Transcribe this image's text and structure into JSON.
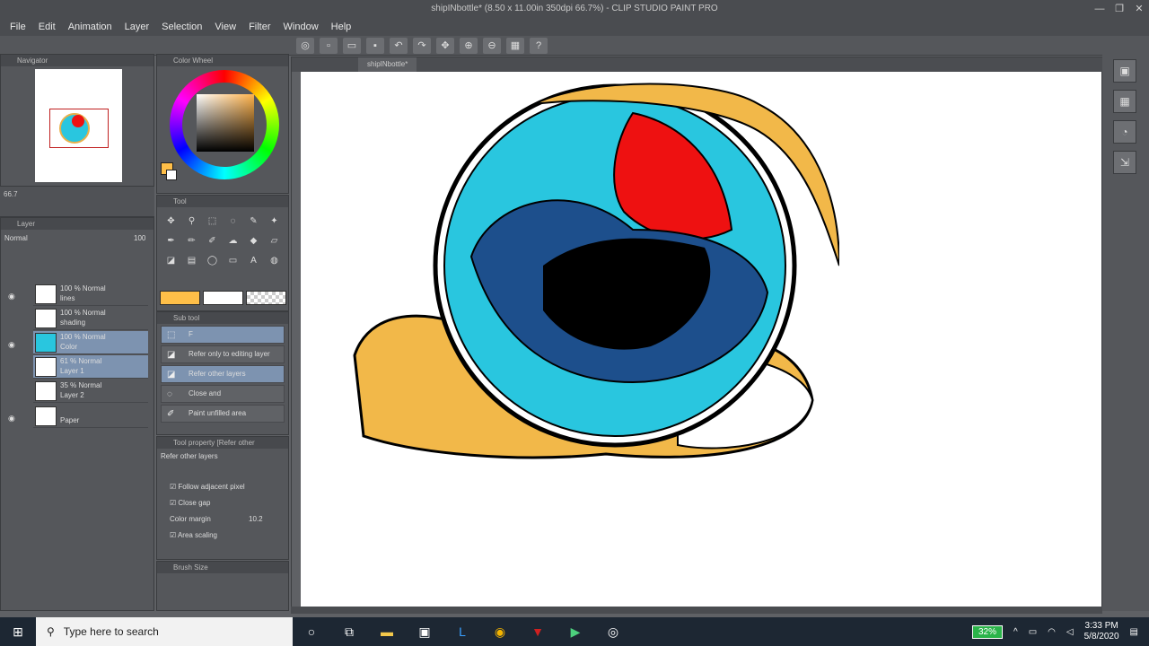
{
  "window": {
    "title": "shipINbottle* (8.50 x 11.00in 350dpi 66.7%) - CLIP STUDIO PAINT PRO",
    "controls": [
      "—",
      "❐",
      "✕"
    ]
  },
  "menu": [
    "File",
    "Edit",
    "Animation",
    "Layer",
    "Selection",
    "View",
    "Filter",
    "Window",
    "Help"
  ],
  "panels": {
    "navigator": "Navigator",
    "color": "Color Wheel",
    "tool": "Tool",
    "subtool": "Sub tool",
    "layer": "Layer",
    "tool_property": "Tool property [Refer other",
    "brush_size": "Brush Size",
    "nav_zoom": "66.7"
  },
  "layer": {
    "blend": "Normal",
    "opacity": "100",
    "rows": [
      {
        "line1": "100 % Normal",
        "line2": "lines"
      },
      {
        "line1": "100 % Normal",
        "line2": "shading"
      },
      {
        "line1": "100 % Normal",
        "line2": "Color"
      },
      {
        "line1": "61 % Normal",
        "line2": "Layer 1"
      },
      {
        "line1": "35 % Normal",
        "line2": "Layer 2"
      },
      {
        "line1": "",
        "line2": "Paper"
      }
    ]
  },
  "subtool": {
    "rows": [
      "F",
      "Refer only to editing layer",
      "Refer other layers",
      "Close and",
      "Paint unfilled area"
    ]
  },
  "tool_property": {
    "name": "Refer other layers",
    "options": [
      "Follow adjacent pixel",
      "Close gap",
      "Color margin",
      "Area scaling"
    ],
    "color_margin_value": "10.2"
  },
  "canvas": {
    "tab": "shipINbottle*"
  },
  "taskbar": {
    "search_placeholder": "Type here to search",
    "battery": "32%",
    "time": "3:33 PM",
    "date": "5/8/2020"
  },
  "colors": {
    "accent": "#ffbf48",
    "selected": "#7d93b0",
    "sea": "#29c6df",
    "rope": "#f2b849"
  }
}
